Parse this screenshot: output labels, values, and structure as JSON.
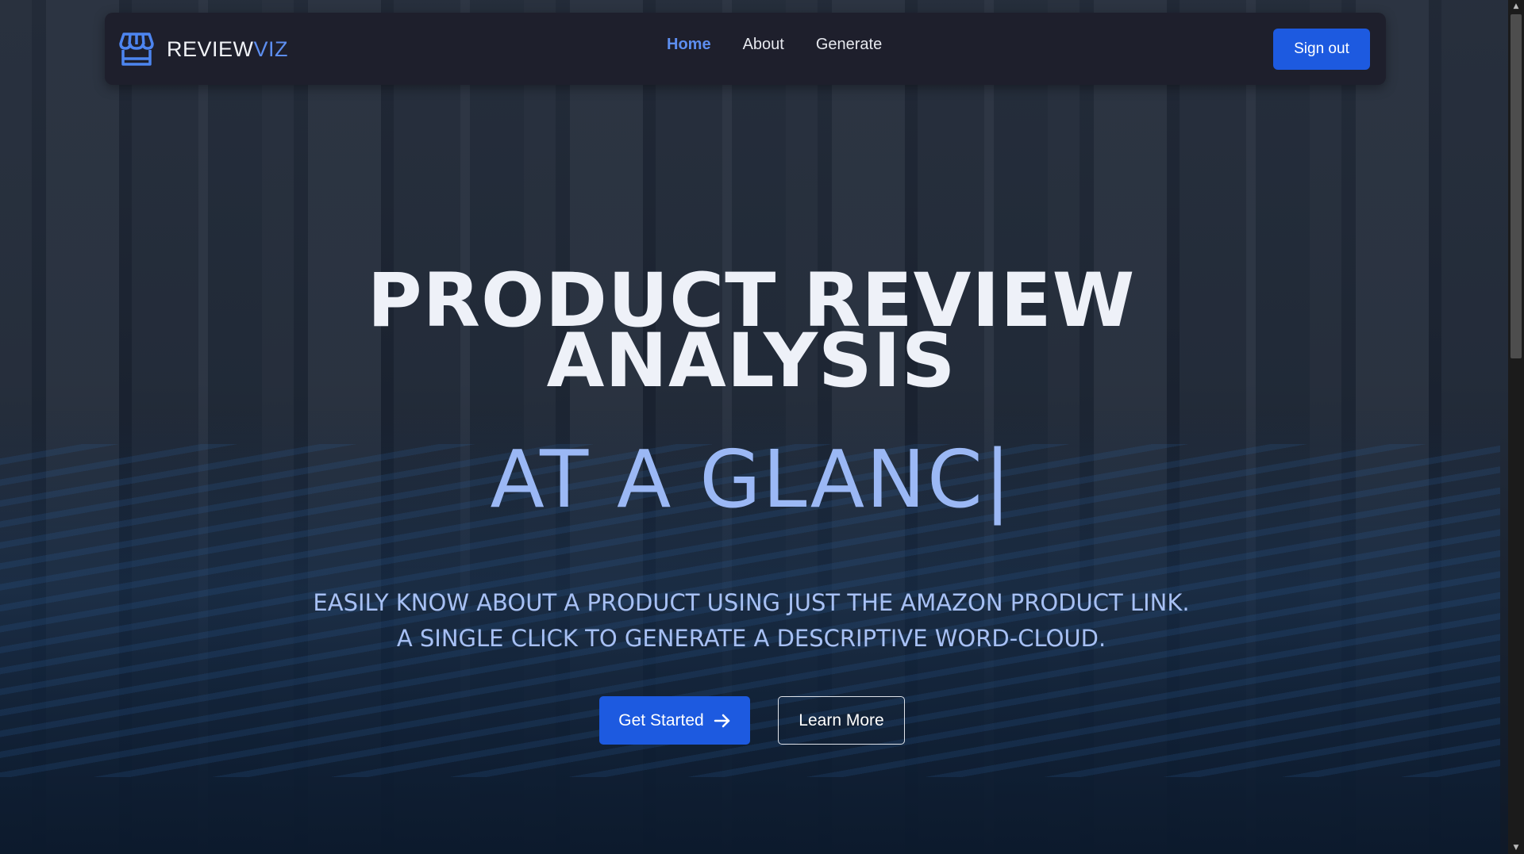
{
  "nav": {
    "brand_main": "REVIEW",
    "brand_accent": "VIZ",
    "brand_icon": "storefront-icon",
    "links": [
      {
        "label": "Home",
        "active": true
      },
      {
        "label": "About",
        "active": false
      },
      {
        "label": "Generate",
        "active": false
      }
    ],
    "signout_label": "Sign out"
  },
  "hero": {
    "title_line1": "PRODUCT REVIEW",
    "title_line2": "ANALYSIS",
    "typed_text": "AT A GLANC",
    "caret": "|",
    "tagline_line1": "EASILY KNOW ABOUT A PRODUCT USING JUST THE AMAZON PRODUCT LINK.",
    "tagline_line2": "A SINGLE CLICK TO GENERATE A DESCRIPTIVE WORD-CLOUD.",
    "primary_button": "Get Started",
    "primary_button_icon": "arrow-right-icon",
    "secondary_button": "Learn More"
  },
  "colors": {
    "accent": "#1d5ae0",
    "brand_accent": "#5d8ef0",
    "navbar_bg": "#1e1f2c",
    "typed_text": "#9bb8f5",
    "tagline": "#a7c0f4"
  }
}
